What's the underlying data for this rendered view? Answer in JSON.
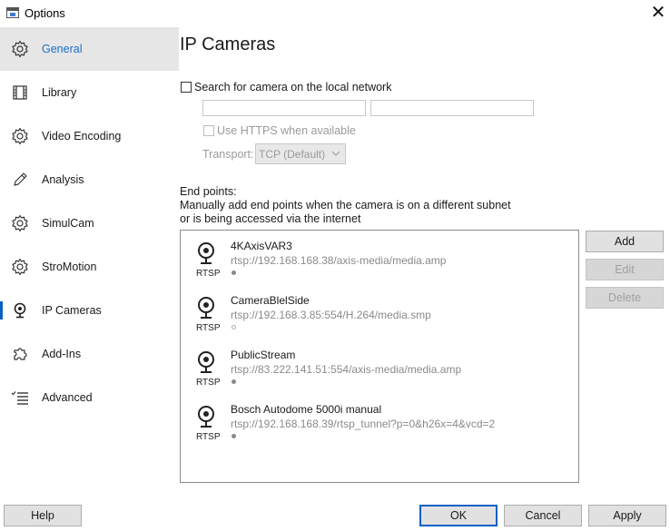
{
  "window": {
    "title": "Options",
    "close_glyph": "✕"
  },
  "sidebar": {
    "items": [
      {
        "label": "General",
        "icon": "gear-icon",
        "selected": true
      },
      {
        "label": "Library",
        "icon": "film-icon"
      },
      {
        "label": "Video Encoding",
        "icon": "gear-icon"
      },
      {
        "label": "Analysis",
        "icon": "pencil-icon"
      },
      {
        "label": "SimulCam",
        "icon": "gear-icon"
      },
      {
        "label": "StroMotion",
        "icon": "gear-icon"
      },
      {
        "label": "IP Cameras",
        "icon": "webcam-icon",
        "active_marker": true
      },
      {
        "label": "Add-Ins",
        "icon": "puzzle-icon"
      },
      {
        "label": "Advanced",
        "icon": "checklist-icon"
      }
    ]
  },
  "content": {
    "title": "IP Cameras",
    "search_label": "Search for camera on the local network",
    "search_checked": false,
    "username_value": "",
    "password_value": "",
    "https_label": "Use HTTPS when available",
    "transport_label": "Transport:",
    "transport_value": "TCP (Default)",
    "endpoints_label": "End points:",
    "endpoints_help_1": "Manually add end points when the camera is on a different subnet",
    "endpoints_help_2": "or is being accessed via the internet",
    "endpoints": [
      {
        "name": "4KAxisVAR3",
        "url": "rtsp://192.168.168.38/axis-media/media.amp",
        "protocol": "RTSP",
        "status": "filled"
      },
      {
        "name": "CameraBlelSide",
        "url": "rtsp://192.168.3.85:554/H.264/media.smp",
        "protocol": "RTSP",
        "status": "hollow"
      },
      {
        "name": "PublicStream",
        "url": "rtsp://83.222.141.51:554/axis-media/media.amp",
        "protocol": "RTSP",
        "status": "filled"
      },
      {
        "name": "Bosch Autodome 5000i manual",
        "url": "rtsp://192.168.168.39/rtsp_tunnel?p=0&h26x=4&vcd=2",
        "protocol": "RTSP",
        "status": "filled"
      }
    ],
    "buttons": {
      "add": "Add",
      "edit": "Edit",
      "delete": "Delete"
    }
  },
  "footer": {
    "help": "Help",
    "ok": "OK",
    "cancel": "Cancel",
    "apply": "Apply"
  },
  "colors": {
    "accent": "#0b60c4",
    "selected_bg": "#e6e6e6",
    "selected_text": "#1e6fc8",
    "button_bg": "#e1e1e1"
  }
}
